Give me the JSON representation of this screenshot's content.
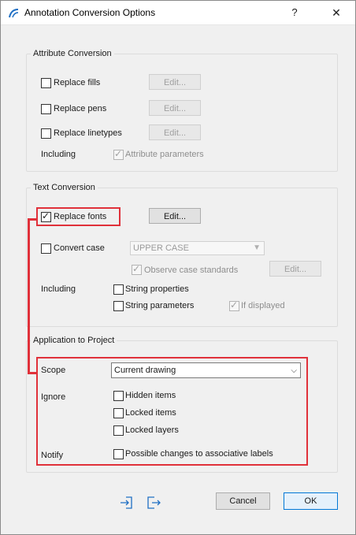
{
  "dialog": {
    "title": "Annotation Conversion Options",
    "help_label": "?",
    "close_label": "✕"
  },
  "attribute_conversion": {
    "title": "Attribute Conversion",
    "replace_fills": {
      "label": "Replace fills",
      "checked": false,
      "edit_label": "Edit..."
    },
    "replace_pens": {
      "label": "Replace pens",
      "checked": false,
      "edit_label": "Edit..."
    },
    "replace_linetypes": {
      "label": "Replace linetypes",
      "checked": false,
      "edit_label": "Edit..."
    },
    "including_label": "Including",
    "attribute_parameters": {
      "label": "Attribute parameters",
      "checked": true
    }
  },
  "text_conversion": {
    "title": "Text Conversion",
    "replace_fonts": {
      "label": "Replace fonts",
      "checked": true,
      "edit_label": "Edit..."
    },
    "convert_case": {
      "label": "Convert case",
      "checked": false
    },
    "case_select": {
      "value": "UPPER CASE"
    },
    "observe_case_standards": {
      "label": "Observe case standards",
      "checked": true,
      "edit_label": "Edit..."
    },
    "including_label": "Including",
    "string_properties": {
      "label": "String properties",
      "checked": false
    },
    "string_parameters": {
      "label": "String parameters",
      "checked": false
    },
    "if_displayed": {
      "label": "If displayed",
      "checked": true
    }
  },
  "application_to_project": {
    "title": "Application to Project",
    "scope_label": "Scope",
    "scope_select": {
      "value": "Current drawing"
    },
    "ignore_label": "Ignore",
    "hidden_items": {
      "label": "Hidden items",
      "checked": false
    },
    "locked_items": {
      "label": "Locked items",
      "checked": false
    },
    "locked_layers": {
      "label": "Locked layers",
      "checked": false
    },
    "notify_label": "Notify",
    "possible_changes": {
      "label": "Possible changes to associative labels",
      "checked": false
    }
  },
  "footer": {
    "cancel_label": "Cancel",
    "ok_label": "OK"
  },
  "colors": {
    "highlight": "#e0313a",
    "accent": "#0078d7"
  }
}
